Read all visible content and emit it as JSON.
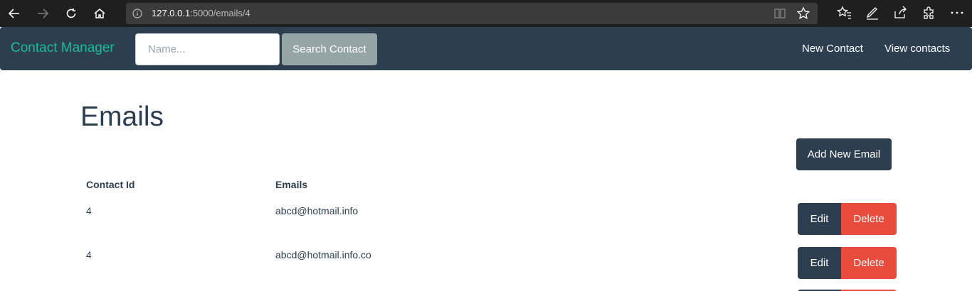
{
  "browser": {
    "url_host": "127.0.0.1",
    "url_path": ":5000/emails/4"
  },
  "navbar": {
    "brand": "Contact Manager",
    "search_placeholder": "Name...",
    "search_button": "Search Contact",
    "links": [
      "New Contact",
      "View contacts"
    ]
  },
  "main": {
    "title": "Emails",
    "add_button": "Add New Email",
    "table": {
      "headers": [
        "Contact Id",
        "Emails"
      ],
      "rows": [
        {
          "contact_id": "4",
          "email": "abcd@hotmail.info",
          "edit": "Edit",
          "delete": "Delete"
        },
        {
          "contact_id": "4",
          "email": "abcd@hotmail.info.co",
          "edit": "Edit",
          "delete": "Delete"
        }
      ]
    }
  },
  "colors": {
    "primary": "#2c3e50",
    "success": "#18bc9c",
    "danger": "#e74c3c",
    "secondary": "#95a5a6"
  }
}
